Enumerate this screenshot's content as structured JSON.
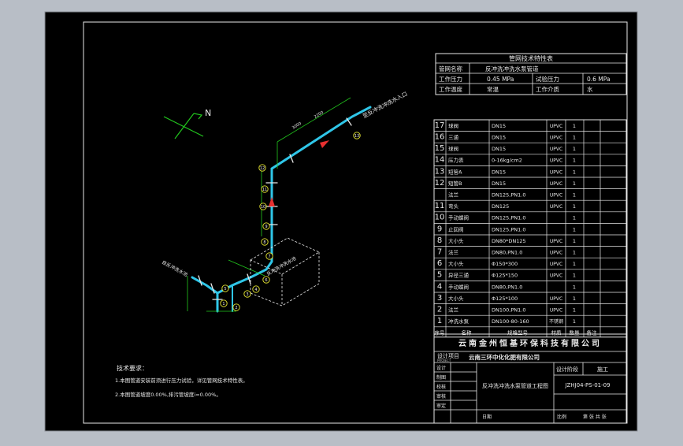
{
  "spec_table": {
    "title": "管网技术特性表",
    "rows": [
      [
        "管网名称",
        "反冲洗冲洗水泵管道"
      ],
      [
        "工作压力",
        "0.45 MPa",
        "试验压力",
        "0.6 MPa"
      ],
      [
        "工作温度",
        "常温",
        "工作介质",
        "水"
      ]
    ]
  },
  "bom": {
    "header": [
      "序号",
      "名称",
      "规格型号",
      "材质",
      "数量",
      "备注"
    ],
    "items": [
      [
        "17",
        "球阀",
        "DN15",
        "UPVC",
        "1"
      ],
      [
        "16",
        "三通",
        "DN15",
        "UPVC",
        "1"
      ],
      [
        "15",
        "球阀",
        "DN15",
        "UPVC",
        "1"
      ],
      [
        "14",
        "压力表",
        "0-16kg/cm2",
        "UPVC",
        "1"
      ],
      [
        "13",
        "短管A",
        "DN15",
        "UPVC",
        "1"
      ],
      [
        "12",
        "短管B",
        "DN15",
        "UPVC",
        "1"
      ],
      [
        "",
        "法兰",
        "DN125,PN1.0",
        "UPVC",
        "1"
      ],
      [
        "11",
        "弯头",
        "DN125",
        "UPVC",
        "1"
      ],
      [
        "10",
        "手动蝶阀",
        "DN125,PN1.0",
        "",
        "1"
      ],
      [
        "9",
        "止回阀",
        "DN125,PN1.0",
        "",
        "1"
      ],
      [
        "8",
        "大小头",
        "DN80*DN125",
        "UPVC",
        "1"
      ],
      [
        "7",
        "法兰",
        "DN80,PN1.0",
        "UPVC",
        "1"
      ],
      [
        "6",
        "大小头",
        "Φ150*300",
        "UPVC",
        "1"
      ],
      [
        "5",
        "异径三通",
        "Φ125*150",
        "UPVC",
        "1"
      ],
      [
        "4",
        "手动蝶阀",
        "DN80,PN1.0",
        "",
        "1"
      ],
      [
        "3",
        "大小头",
        "Φ125*100",
        "UPVC",
        "1"
      ],
      [
        "2",
        "法兰",
        "DN100,PN1.0",
        "UPVC",
        "1"
      ],
      [
        "1",
        "冲洗水泵",
        "DN100-80-160",
        "不锈钢",
        "1"
      ]
    ]
  },
  "title_block": {
    "company": "云南金州恒基环保科技有限公司",
    "project_label": "设计项目",
    "project_sub": "PROJECT",
    "client": "云南三环中化化肥有限公司",
    "drawing_name": "反冲洗冲洗水泵管道工程图",
    "stage_label": "设计阶段",
    "stage_value": "施工",
    "drawing_no": "JZHJ04-PS-01-09",
    "row_labels": [
      "设计",
      "制图",
      "校核",
      "审核",
      "审定"
    ],
    "scale_label": "比例",
    "sheet_label": "第 张 共 张",
    "date_label": "日期"
  },
  "notes": {
    "title": "技术要求：",
    "lines": [
      "1.本图管道安装前须进行压力试验，详见管网技术特性表。",
      "2.本图管道坡度0.00%,排污管坡度i=0.00%。"
    ]
  },
  "pipe_labels": {
    "north": "N",
    "outlet": "至反冲洗冲洗水入口",
    "inlet": "自反冲洗水池",
    "tank": "反冲洗冲洗水池",
    "dim_a": "3000",
    "dim_b": "2200"
  },
  "balloons": [
    "1",
    "2",
    "3",
    "4",
    "5",
    "6",
    "7",
    "8",
    "9",
    "10",
    "11",
    "12",
    "13"
  ]
}
